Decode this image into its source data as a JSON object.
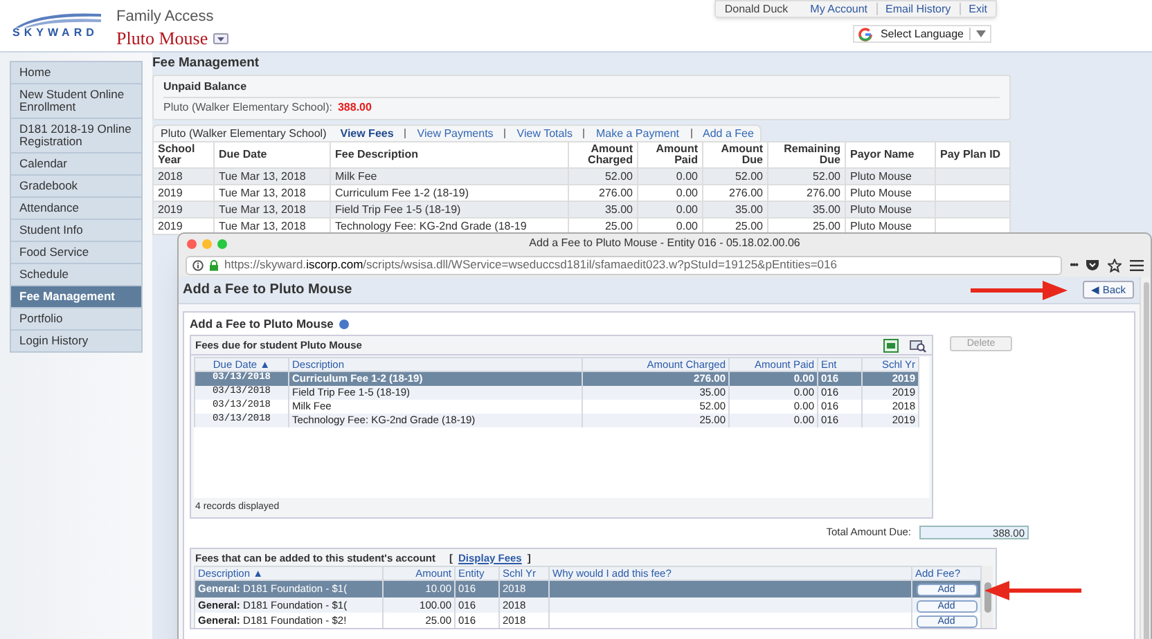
{
  "header": {
    "logo_text": "SKYWARD",
    "app_title": "Family Access",
    "student_name": "Pluto Mouse",
    "top_links": [
      "Donald Duck",
      "My Account",
      "Email History",
      "Exit"
    ],
    "language": "Select Language"
  },
  "sidebar": {
    "items": [
      {
        "label": "Home",
        "selected": false
      },
      {
        "label": "New Student Online Enrollment",
        "selected": false
      },
      {
        "label": "D181 2018-19 Online Registration",
        "selected": false
      },
      {
        "label": "Calendar",
        "selected": false
      },
      {
        "label": "Gradebook",
        "selected": false
      },
      {
        "label": "Attendance",
        "selected": false
      },
      {
        "label": "Student Info",
        "selected": false
      },
      {
        "label": "Food Service",
        "selected": false
      },
      {
        "label": "Schedule",
        "selected": false
      },
      {
        "label": "Fee Management",
        "selected": true
      },
      {
        "label": "Portfolio",
        "selected": false
      },
      {
        "label": "Login History",
        "selected": false
      }
    ]
  },
  "page_title": "Fee Management",
  "unpaid_balance": {
    "title": "Unpaid Balance",
    "label": "Pluto (Walker Elementary School):",
    "amount": "388.00"
  },
  "student_tab": "Pluto (Walker Elementary School)",
  "tabs": [
    {
      "label": "View Fees",
      "selected": true
    },
    {
      "label": "View Payments",
      "selected": false
    },
    {
      "label": "View Totals",
      "selected": false
    },
    {
      "label": "Make a Payment",
      "selected": false
    },
    {
      "label": "Add a Fee",
      "selected": false
    }
  ],
  "fees_table": {
    "columns": [
      "School Year",
      "Due Date",
      "Fee Description",
      "Amount Charged",
      "Amount Paid",
      "Amount Due",
      "Remaining Due",
      "Payor Name",
      "Pay Plan ID"
    ],
    "rows": [
      [
        "2018",
        "Tue Mar 13, 2018",
        "Milk Fee",
        "52.00",
        "0.00",
        "52.00",
        "52.00",
        "Pluto Mouse"
      ],
      [
        "2019",
        "Tue Mar 13, 2018",
        "Curriculum Fee 1-2 (18-19)",
        "276.00",
        "0.00",
        "276.00",
        "276.00",
        "Pluto Mouse"
      ],
      [
        "2019",
        "Tue Mar 13, 2018",
        "Field Trip Fee 1-5 (18-19)",
        "35.00",
        "0.00",
        "35.00",
        "35.00",
        "Pluto Mouse"
      ],
      [
        "2019",
        "Tue Mar 13, 2018",
        "Technology Fee: KG-2nd Grade (18-19",
        "25.00",
        "0.00",
        "25.00",
        "25.00",
        "Pluto Mouse"
      ]
    ]
  },
  "popup": {
    "window_title": "Add a Fee to Pluto Mouse - Entity 016 - 05.18.02.00.06",
    "url_prefix": "https://skyward.",
    "url_domain": "iscorp.com",
    "url_rest": "/scripts/wsisa.dll/WService=wseduccsd181il/sfamaedit023.w?pStuId=19125&pEntities=016",
    "more": "•••",
    "page_title": "Add a Fee to Pluto Mouse",
    "back": "◀ Back",
    "section_title": "Add a Fee to Pluto Mouse",
    "due_grid": {
      "title": "Fees due for student Pluto Mouse",
      "delete": "Delete",
      "columns": [
        "Due Date ▲",
        "Description",
        "Amount Charged",
        "Amount Paid",
        "Ent",
        "Schl Yr"
      ],
      "rows": [
        {
          "cells": [
            "03/13/2018",
            "Curriculum Fee 1-2 (18-19)",
            "276.00",
            "0.00",
            "016",
            "2019"
          ],
          "selected": true
        },
        {
          "cells": [
            "03/13/2018",
            "Field Trip Fee 1-5 (18-19)",
            "35.00",
            "0.00",
            "016",
            "2019"
          ],
          "selected": false
        },
        {
          "cells": [
            "03/13/2018",
            "Milk Fee",
            "52.00",
            "0.00",
            "016",
            "2018"
          ],
          "selected": false
        },
        {
          "cells": [
            "03/13/2018",
            "Technology Fee: KG-2nd Grade (18-19)",
            "25.00",
            "0.00",
            "016",
            "2019"
          ],
          "selected": false
        }
      ],
      "footer": "4 records displayed"
    },
    "total_label": "Total Amount Due:",
    "total_value": "388.00",
    "add_grid": {
      "title": "Fees that can be added to this student's account",
      "link_open": "[",
      "link": "Display Fees",
      "link_close": "]",
      "columns": [
        "Description ▲",
        "Amount",
        "Entity",
        "Schl Yr",
        "Why would I add this fee?",
        "Add Fee?"
      ],
      "rows": [
        {
          "description": "**General:** D181 Foundation - $1(",
          "amount": "10.00",
          "entity": "016",
          "year": "2018",
          "action": "Add",
          "selected": true
        },
        {
          "description": "**General:** D181 Foundation - $1(",
          "amount": "100.00",
          "entity": "016",
          "year": "2018",
          "action": "Add",
          "selected": false
        },
        {
          "description": "**General:** D181 Foundation - $2!",
          "amount": "25.00",
          "entity": "016",
          "year": "2018",
          "action": "Add",
          "selected": false
        }
      ]
    }
  }
}
